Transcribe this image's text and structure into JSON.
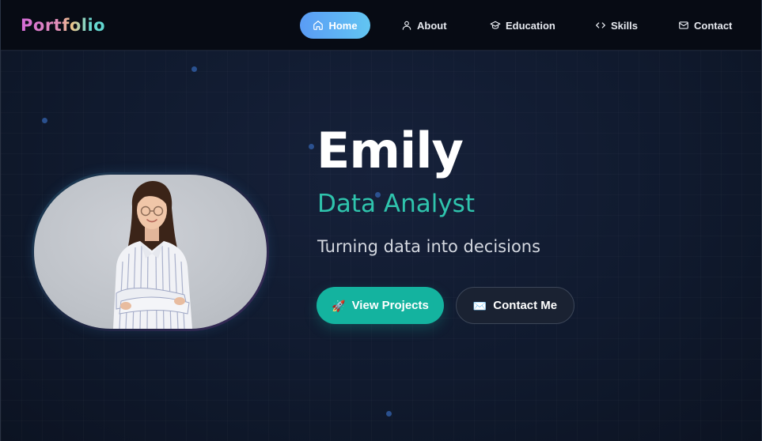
{
  "brand": {
    "name": "Portfolio"
  },
  "nav": {
    "items": [
      {
        "label": "Home",
        "icon": "home-icon",
        "active": true
      },
      {
        "label": "About",
        "icon": "user-icon",
        "active": false
      },
      {
        "label": "Education",
        "icon": "graduation-cap-icon",
        "active": false
      },
      {
        "label": "Skills",
        "icon": "code-icon",
        "active": false
      },
      {
        "label": "Contact",
        "icon": "mail-icon",
        "active": false
      }
    ]
  },
  "hero": {
    "name": "Emily",
    "role": "Data Analyst",
    "tagline": "Turning data into decisions",
    "primary_button": {
      "emoji": "🚀",
      "label": "View Projects"
    },
    "secondary_button": {
      "emoji": "✉️",
      "label": "Contact Me"
    },
    "photo": {
      "description_icon": "profile-photo"
    }
  },
  "colors": {
    "accent_teal": "#14b39f",
    "role_teal": "#2fc4ad",
    "nav_active_start": "#5a9cf5",
    "nav_active_end": "#62c5f2",
    "background": "#101a2e",
    "navbar_background": "#070b14"
  }
}
